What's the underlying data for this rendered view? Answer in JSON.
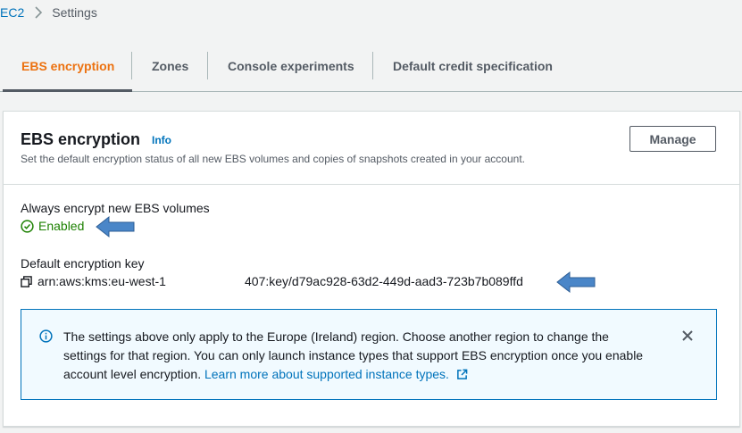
{
  "breadcrumb": {
    "items": [
      "EC2",
      "Settings"
    ]
  },
  "tabs": [
    {
      "label": "EBS encryption",
      "active": true
    },
    {
      "label": "Zones"
    },
    {
      "label": "Console experiments"
    },
    {
      "label": "Default credit specification"
    }
  ],
  "panel": {
    "title": "EBS encryption",
    "info_label": "Info",
    "description": "Set the default encryption status of all new EBS volumes and copies of snapshots created in your account.",
    "manage_label": "Manage"
  },
  "always_encrypt": {
    "label": "Always encrypt new EBS volumes",
    "status": "Enabled",
    "status_color": "#1d8102"
  },
  "default_key": {
    "label": "Default encryption key",
    "value_prefix": "arn:aws:kms:eu-west-1",
    "value_suffix": "407:key/d79ac928-63d2-449d-aad3-723b7b089ffd"
  },
  "alert": {
    "text": "The settings above only apply to the Europe (Ireland) region. Choose another region to change the settings for that region. You can only launch instance types that support EBS encryption once you enable account level encryption.",
    "link_text": "Learn more about supported instance types."
  },
  "colors": {
    "accent": "#ec7211",
    "link": "#0073bb",
    "annotation_arrow": "#4a86c8"
  },
  "icons": [
    "chevron-right-icon",
    "check-circle-icon",
    "copy-icon",
    "info-icon",
    "close-icon",
    "external-link-icon",
    "arrow-left-icon"
  ]
}
